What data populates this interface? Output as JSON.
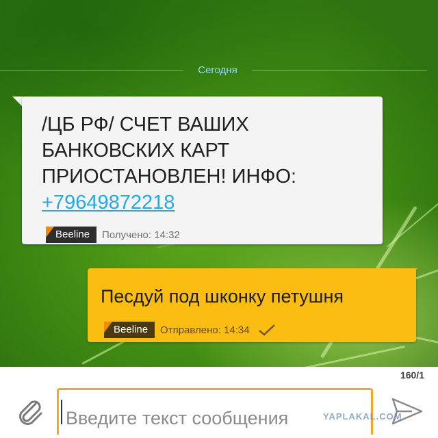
{
  "conversation": {
    "date_separator": "Сегодня",
    "background_color": "#4c9a18"
  },
  "incoming_message": {
    "text": "/ЦБ РФ/ СЧЕТ ВАШИХ БАНКОВСКИХ КАРТ ПРИОСТАНОВЛЕН! ИНФО:",
    "phone_link": "+79649872218",
    "operator": "Beeline",
    "status": "Получено: 14:32",
    "link_color": "#27a8e0"
  },
  "outgoing_message": {
    "text": "Песдуй под шконку петушня",
    "operator": "Beeline",
    "status": "Отправлено: 14:34",
    "status_icon": "checkmark-icon",
    "bubble_color": "#fbbd12"
  },
  "composer": {
    "char_counter": "160/1",
    "placeholder": "Введите текст сообщения",
    "attach_icon": "paperclip-icon",
    "send_icon": "send-arrow-icon",
    "accent_color": "#f5a623"
  },
  "watermark": "YAPLAKAL.COM"
}
